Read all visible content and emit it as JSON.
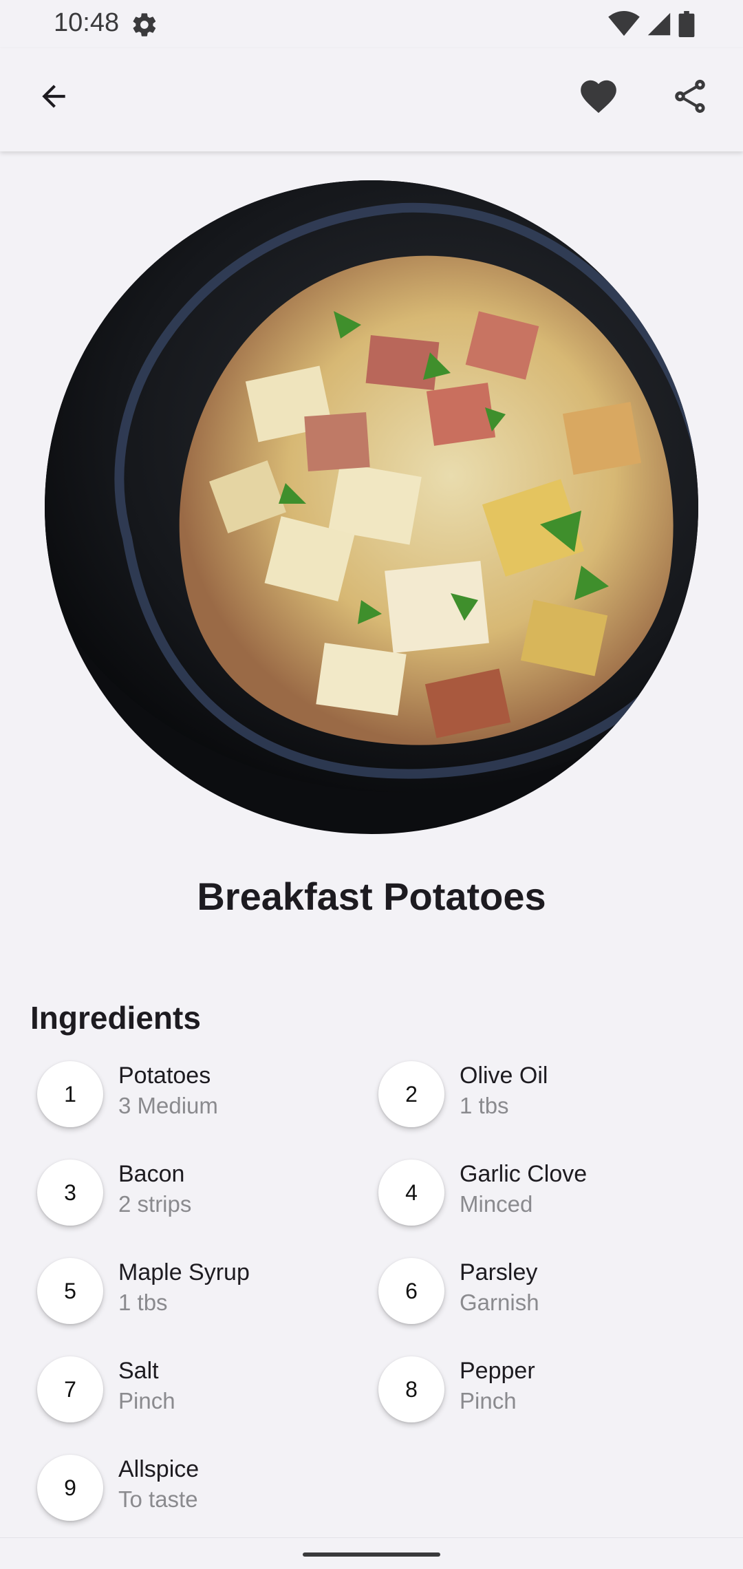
{
  "status_bar": {
    "time": "10:48"
  },
  "app_bar": {
    "back_icon": "arrow-back-icon",
    "favorite_icon": "heart-icon",
    "share_icon": "share-icon"
  },
  "recipe": {
    "title": "Breakfast Potatoes",
    "image_alt": "Breakfast potatoes in a cast iron skillet"
  },
  "ingredients_section": {
    "heading": "Ingredients",
    "items": [
      {
        "number": "1",
        "name": "Potatoes",
        "quantity": "3 Medium"
      },
      {
        "number": "2",
        "name": "Olive Oil",
        "quantity": "1 tbs"
      },
      {
        "number": "3",
        "name": "Bacon",
        "quantity": "2 strips"
      },
      {
        "number": "4",
        "name": "Garlic Clove",
        "quantity": "Minced"
      },
      {
        "number": "5",
        "name": "Maple Syrup",
        "quantity": "1 tbs"
      },
      {
        "number": "6",
        "name": "Parsley",
        "quantity": "Garnish"
      },
      {
        "number": "7",
        "name": "Salt",
        "quantity": "Pinch"
      },
      {
        "number": "8",
        "name": "Pepper",
        "quantity": "Pinch"
      },
      {
        "number": "9",
        "name": "Allspice",
        "quantity": "To taste"
      }
    ]
  },
  "colors": {
    "background": "#f3f2f6",
    "primary_text": "#1d1b20",
    "secondary_text": "#8a8a8e",
    "icon": "#3a3a3c"
  }
}
